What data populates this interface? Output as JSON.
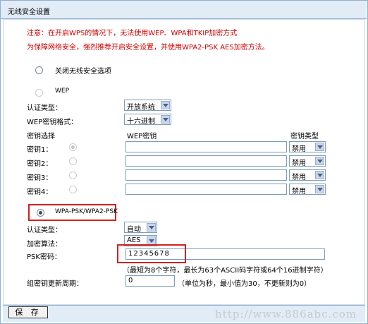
{
  "page": {
    "title": "无线安全设置"
  },
  "notice": {
    "line1": "注意：在开启WPS的情况下，无法使用WEP、WPA和TKIP加密方式",
    "line2": "为保障网络安全，强烈推荐开启安全设置，并使用WPA2-PSK AES加密方法。"
  },
  "disable_security": {
    "label": "关闭无线安全选项"
  },
  "wep": {
    "label": "WEP",
    "auth_type_label": "认证类型：",
    "auth_type_value": "开放系统",
    "key_format_label": "WEP密钥格式：",
    "key_format_value": "十六进制",
    "col_key_select": "密钥选择",
    "col_wep_key": "WEP密钥",
    "col_key_type": "密钥类型",
    "keys": [
      {
        "label": "密钥1：",
        "value": "",
        "type": "禁用"
      },
      {
        "label": "密钥2：",
        "value": "",
        "type": "禁用"
      },
      {
        "label": "密钥3：",
        "value": "",
        "type": "禁用"
      },
      {
        "label": "密钥4：",
        "value": "",
        "type": "禁用"
      }
    ]
  },
  "wpa": {
    "label": "WPA-PSK/WPA2-PSK",
    "auth_type_label": "认证类型：",
    "auth_type_value": "自动",
    "encryption_label": "加密算法：",
    "encryption_value": "AES",
    "psk_label": "PSK密码：",
    "psk_value": "12345678",
    "psk_hint": "（最短为8个字符，最长为63个ASCII码字符或64个16进制字符）",
    "group_key_label": "组密钥更新周期：",
    "group_key_value": "0",
    "group_key_hint": "（单位为秒，最小值为30，不更新则为0）"
  },
  "actions": {
    "save_label": "保 存"
  },
  "watermark": "http://www.886abc.com",
  "colors": {
    "notice_red": "#cc0000",
    "highlight_red": "#d42020",
    "bar_blue": "#e1ecf7"
  }
}
